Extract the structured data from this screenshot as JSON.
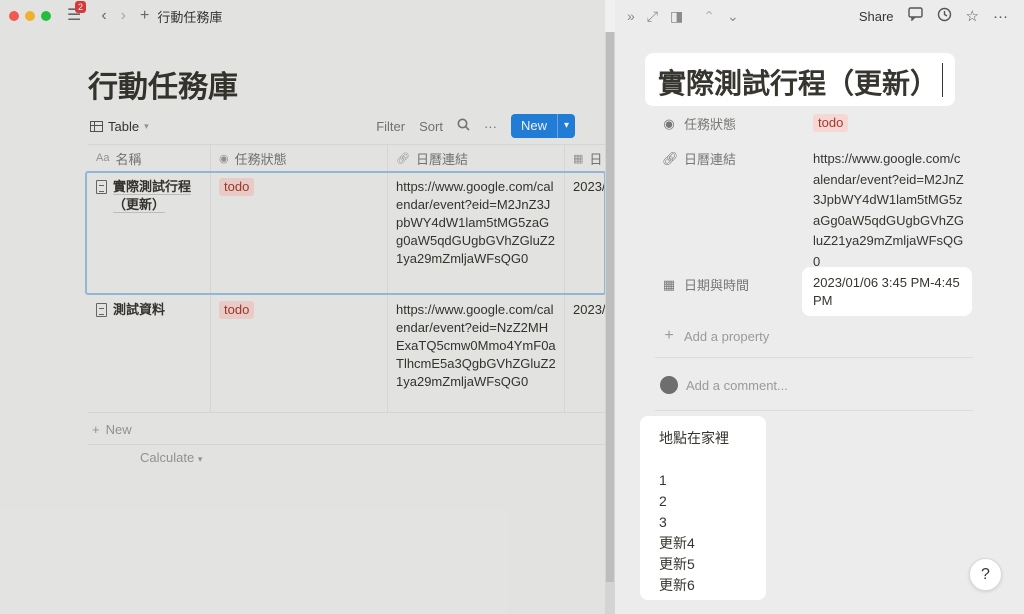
{
  "window": {
    "traffic_colors": [
      "#ff5f57",
      "#febc2e",
      "#28c840"
    ],
    "notification_count": "2",
    "breadcrumb": "行動任務庫"
  },
  "database": {
    "title": "行動任務庫",
    "view_tab": "Table",
    "actions": {
      "filter": "Filter",
      "sort": "Sort",
      "more": "···",
      "new": "New"
    },
    "columns": [
      {
        "label": "名稱",
        "icon": "Aa"
      },
      {
        "label": "任務狀態",
        "icon": "status-icon"
      },
      {
        "label": "日曆連結",
        "icon": "link-icon"
      },
      {
        "label": "日",
        "icon": "calendar-icon"
      }
    ],
    "rows": [
      {
        "name": "實際測試行程（更新）",
        "status": "todo",
        "link": "https://www.google.com/calendar/event?eid=M2JnZ3JpbWY4dW1lam5tMG5zaGg0aW5qdGUgbGVhZGluZ21ya29mZmljaWFsQG0",
        "date": "2023/"
      },
      {
        "name": "測試資料",
        "status": "todo",
        "link": "https://www.google.com/calendar/event?eid=NzZ2MHExaTQ5cmw0Mmo4YmF0aTlhcmE5a3QgbGVhZGluZ21ya29mZmljaWFsQG0",
        "date": "2023/"
      }
    ],
    "add_new": "New",
    "calculate": "Calculate"
  },
  "detail": {
    "topbar": {
      "share": "Share"
    },
    "title": "實際測試行程（更新）",
    "properties": [
      {
        "label": "任務狀態",
        "value": "todo"
      },
      {
        "label": "日曆連結",
        "value": "https://www.google.com/calendar/event?eid=M2JnZ3JpbWY4dW1lam5tMG5zaGg0aW5qdGUgbGVhZGluZ21ya29mZmljaWFsQG0"
      },
      {
        "label": "日期與時間",
        "value": "2023/01/06 3:45 PM-4:45 PM"
      }
    ],
    "add_property": "Add a property",
    "add_comment": "Add a comment...",
    "body": [
      "地點在家裡",
      "",
      "1",
      "2",
      "3",
      "更新4",
      "更新5",
      "更新6"
    ],
    "help": "?"
  },
  "colors": {
    "accent": "#2383e2",
    "tag_bg": "#f6d7d3",
    "tag_text": "#a33a2b"
  }
}
